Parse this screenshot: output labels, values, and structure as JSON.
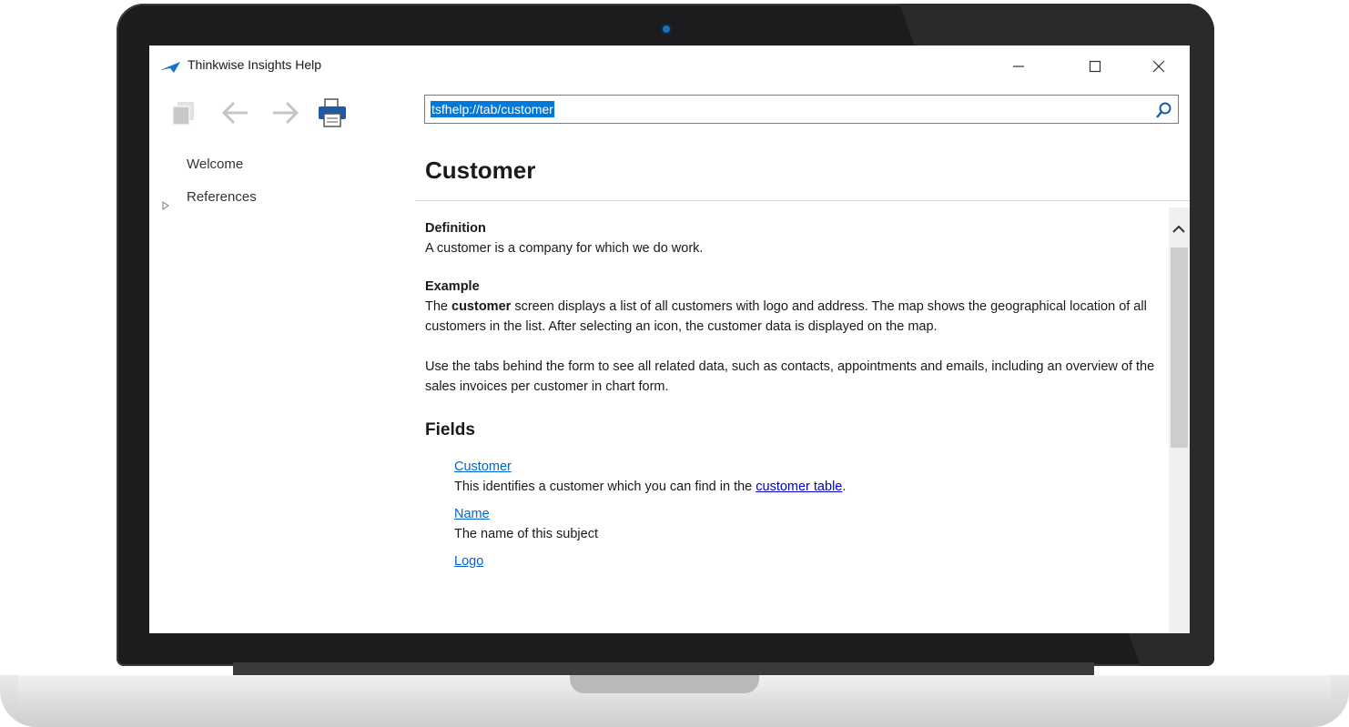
{
  "window": {
    "title": "Thinkwise Insights Help"
  },
  "address": {
    "url": "tsfhelp://tab/customer"
  },
  "nav": {
    "items": [
      {
        "label": "Welcome"
      },
      {
        "label": "References"
      }
    ]
  },
  "page": {
    "title": "Customer",
    "definition_heading": "Definition",
    "definition_text": "A customer is a company for which we do work.",
    "example_heading": "Example",
    "example_pre": "The ",
    "example_bold": "customer",
    "example_post": " screen displays a list of all customers with logo and address. The map shows the geographical location of all customers in the list. After selecting an icon, the customer data is displayed on the map.",
    "tabs_text": "Use the tabs behind the form to see all related data, such as contacts, appointments and emails, including an overview of the sales invoices per customer in chart form.",
    "fields_heading": "Fields",
    "fields": [
      {
        "name": "Customer",
        "desc_pre": "This identifies a customer which you can find in the ",
        "desc_link": "customer table",
        "desc_post": "."
      },
      {
        "name": "Name",
        "desc_pre": "The name of this subject",
        "desc_link": "",
        "desc_post": ""
      },
      {
        "name": "Logo"
      }
    ]
  },
  "icons": [
    "app-logo-icon",
    "sync-toc-icon",
    "back-arrow-icon",
    "forward-arrow-icon",
    "print-icon",
    "search-icon",
    "minimize-icon",
    "maximize-icon",
    "close-icon",
    "expand-icon",
    "scroll-up-icon"
  ]
}
